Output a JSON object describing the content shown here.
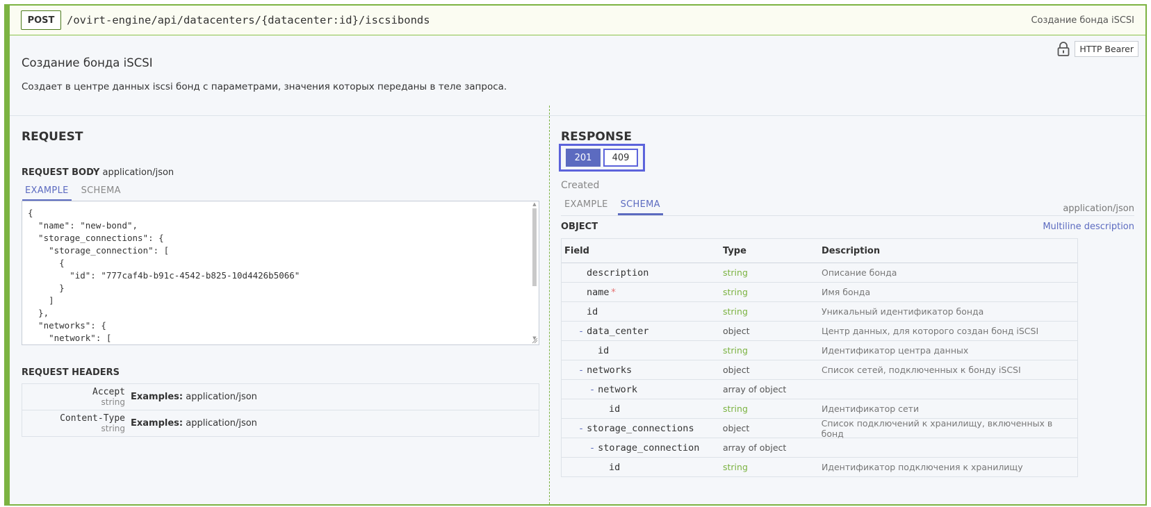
{
  "operation": {
    "method": "POST",
    "path": "/ovirt-engine/api/datacenters/{datacenter:id}/iscsibonds",
    "summary": "Создание бонда iSCSI",
    "title": "Создание бонда iSCSI",
    "description": "Создает в центре данных iscsi бонд с параметрами, значения которых переданы в теле запроса.",
    "auth_label": "HTTP Bearer",
    "lock_icon": "lock-icon"
  },
  "request": {
    "heading": "REQUEST",
    "body_label": "REQUEST BODY",
    "body_content_type": "application/json",
    "tabs": [
      "EXAMPLE",
      "SCHEMA"
    ],
    "active_tab": "EXAMPLE",
    "example_code": "{\n  \"name\": \"new-bond\",\n  \"storage_connections\": {\n    \"storage_connection\": [\n      {\n        \"id\": \"777caf4b-b91c-4542-b825-10d4426b5066\"\n      }\n    ]\n  },\n  \"networks\": {\n    \"network\": [",
    "headers_label": "REQUEST HEADERS",
    "headers": [
      {
        "name": "Accept",
        "type": "string",
        "examples_label": "Examples:",
        "example": "application/json"
      },
      {
        "name": "Content-Type",
        "type": "string",
        "examples_label": "Examples:",
        "example": "application/json"
      }
    ]
  },
  "response": {
    "heading": "RESPONSE",
    "codes": [
      "201",
      "409"
    ],
    "selected_code": "201",
    "status_text": "Created",
    "tabs": [
      "EXAMPLE",
      "SCHEMA"
    ],
    "active_tab": "SCHEMA",
    "content_type": "application/json",
    "object_label": "OBJECT",
    "multiline_link": "Multiline description",
    "columns": [
      "Field",
      "Type",
      "Description"
    ],
    "fields": [
      {
        "name": "description",
        "type": "string",
        "desc": "Описание бонда",
        "required": false,
        "level": 1,
        "collapsible": false
      },
      {
        "name": "name",
        "type": "string",
        "desc": "Имя бонда",
        "required": true,
        "level": 1,
        "collapsible": false
      },
      {
        "name": "id",
        "type": "string",
        "desc": "Уникальный идентификатор бонда",
        "required": false,
        "level": 1,
        "collapsible": false
      },
      {
        "name": "data_center",
        "type": "object",
        "desc": "Центр данных, для которого создан бонд iSCSI",
        "required": false,
        "level": 1,
        "collapsible": true
      },
      {
        "name": "id",
        "type": "string",
        "desc": "Идентификатор центра данных",
        "required": false,
        "level": 2,
        "collapsible": false
      },
      {
        "name": "networks",
        "type": "object",
        "desc": "Список сетей, подключенных к бонду iSCSI",
        "required": false,
        "level": 1,
        "collapsible": true
      },
      {
        "name": "network",
        "type": "array of object",
        "desc": "",
        "required": false,
        "level": 2,
        "collapsible": true
      },
      {
        "name": "id",
        "type": "string",
        "desc": "Идентификатор сети",
        "required": false,
        "level": 3,
        "collapsible": false
      },
      {
        "name": "storage_connections",
        "type": "object",
        "desc": "Список подключений к хранилищу, включенных в бонд",
        "required": false,
        "level": 1,
        "collapsible": true
      },
      {
        "name": "storage_connection",
        "type": "array of object",
        "desc": "",
        "required": false,
        "level": 2,
        "collapsible": true
      },
      {
        "name": "id",
        "type": "string",
        "desc": "Идентификатор подключения к хранилищу",
        "required": false,
        "level": 3,
        "collapsible": false
      }
    ],
    "collapse_glyph": "-",
    "required_glyph": "*"
  },
  "colors": {
    "accent": "#5c6bc0",
    "border_green": "#7cb342",
    "string_type": "#7cb342"
  }
}
